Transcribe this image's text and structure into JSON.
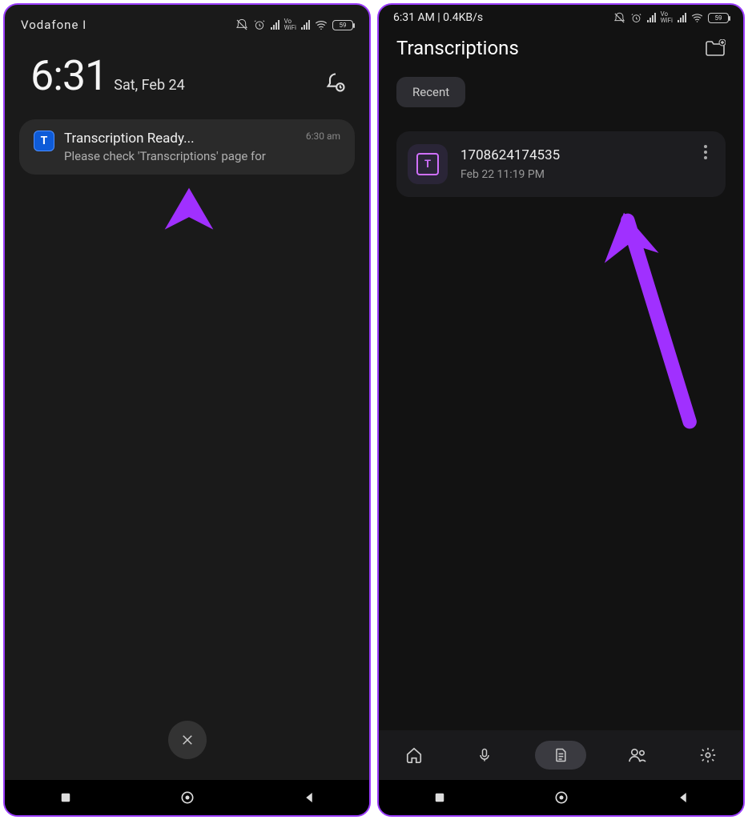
{
  "left": {
    "statusbar": {
      "carrier": "Vodafone I",
      "battery": "59"
    },
    "clock": {
      "time": "6:31",
      "date": "Sat, Feb 24"
    },
    "notification": {
      "title": "Transcription Ready...",
      "body": "Please check 'Transcriptions' page for",
      "time": "6:30 am",
      "icon_letter": "T"
    }
  },
  "right": {
    "statusbar": {
      "left": "6:31 AM | 0.4KB/s",
      "battery": "59"
    },
    "page_title": "Transcriptions",
    "filter": "Recent",
    "transcription": {
      "name": "1708624174535",
      "date": "Feb 22 11:19 PM",
      "icon_letter": "T"
    }
  },
  "colors": {
    "accent": "#9b3dff",
    "arrow": "#a030ff"
  }
}
